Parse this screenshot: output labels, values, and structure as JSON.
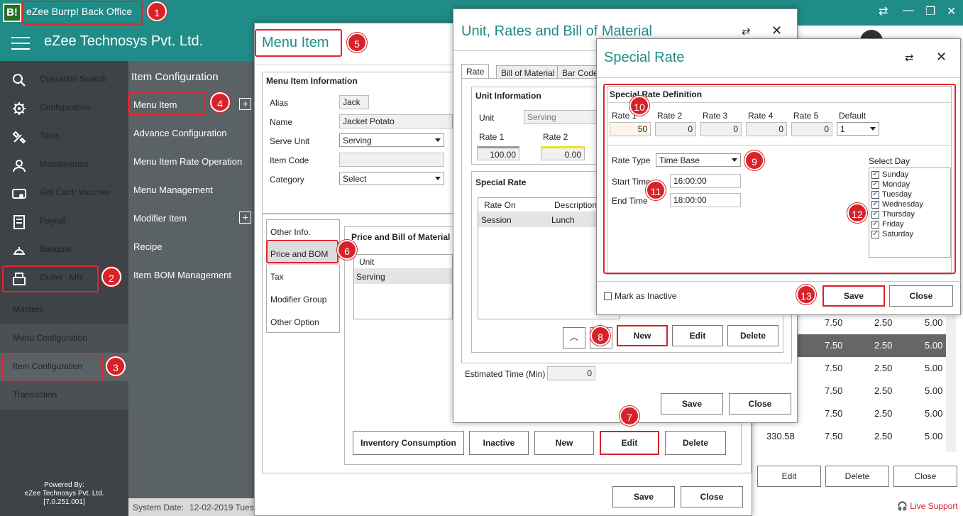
{
  "app": {
    "title": "eZee Burrp! Back Office",
    "logo_text": "B!",
    "company": "eZee Technosys Pvt. Ltd.",
    "brand_color": "#1f8c87"
  },
  "nav": {
    "items": [
      {
        "label": "Operation Search",
        "icon": "search-icon"
      },
      {
        "label": "Configuration",
        "icon": "gear-icon"
      },
      {
        "label": "Tools",
        "icon": "tools-icon"
      },
      {
        "label": "Maintenance",
        "icon": "worker-icon"
      },
      {
        "label": "Gift Card/ Voucher",
        "icon": "gift-card-icon"
      },
      {
        "label": "Payroll",
        "icon": "payroll-icon"
      },
      {
        "label": "Banquet",
        "icon": "banquet-icon"
      },
      {
        "label": "Outlet : MR",
        "icon": "register-icon"
      }
    ],
    "sections": [
      "Masters",
      "Menu Configuration",
      "Item Configuration",
      "Transaction"
    ],
    "powered_by": "Powered By:",
    "powered_company": "eZee Technosys Pvt. Ltd.",
    "version": "[7.0.251.001]"
  },
  "subnav": {
    "header": "Item Configuration",
    "items": [
      "Menu Item",
      "Advance Configuration",
      "Menu Item Rate Operation",
      "Menu Management",
      "Modifier Item",
      "Recipe",
      "Item BOM Management"
    ]
  },
  "status": {
    "system_date_label": "System Date:",
    "system_date": "12-02-2019 Tues"
  },
  "background_table": {
    "rows": [
      {
        "c1": "",
        "c2": "7.50",
        "c3": "2.50",
        "c4": "5.00"
      },
      {
        "c1": "",
        "c2": "7.50",
        "c3": "2.50",
        "c4": "5.00"
      },
      {
        "c1": "",
        "c2": "7.50",
        "c3": "2.50",
        "c4": "5.00"
      },
      {
        "c1": "",
        "c2": "7.50",
        "c3": "2.50",
        "c4": "5.00"
      },
      {
        "c1": "",
        "c2": "7.50",
        "c3": "2.50",
        "c4": "5.00"
      },
      {
        "c1": "330.58",
        "c2": "7.50",
        "c3": "2.50",
        "c4": "5.00"
      }
    ],
    "buttons": {
      "edit": "Edit",
      "delete": "Delete",
      "close": "Close"
    },
    "live_support": "Live Support"
  },
  "menu_item": {
    "title": "Menu Item",
    "info_header": "Menu Item Information",
    "alias_label": "Alias",
    "alias": "Jack",
    "name_label": "Name",
    "name": "Jacket Potato",
    "serve_unit_label": "Serve Unit",
    "serve_unit": "Serving",
    "item_code_label": "Item Code",
    "item_code": "",
    "category_label": "Category",
    "category": "Select",
    "side_tabs": [
      "Other Info.",
      "Price and BOM",
      "Tax",
      "Modifier Group",
      "Other Option"
    ],
    "price_header": "Price and Bill of Material",
    "unit_col": "Unit",
    "unit_row": "Serving",
    "buttons": {
      "inventory": "Inventory Consumption",
      "inactive": "Inactive",
      "new": "New",
      "edit": "Edit",
      "delete": "Delete",
      "save": "Save",
      "close": "Close"
    }
  },
  "unit_rates": {
    "title": "Unit, Rates and Bill of Material",
    "tabs": [
      "Rate",
      "Bill of Material",
      "Bar Code"
    ],
    "unit_info_header": "Unit Information",
    "unit_label": "Unit",
    "unit": "Serving",
    "rate1_label": "Rate 1",
    "rate1": "100.00",
    "rate2_label": "Rate 2",
    "rate2": "0.00",
    "special_rate_header": "Special Rate",
    "grid_cols": [
      "Rate On",
      "Description"
    ],
    "grid_row": [
      "Session",
      "Lunch"
    ],
    "buttons": {
      "new": "New",
      "edit": "Edit",
      "delete": "Delete",
      "save": "Save",
      "close": "Close"
    },
    "est_time_label": "Estimated Time (Min)",
    "est_time": "0"
  },
  "special_rate": {
    "title": "Special Rate",
    "definition_header": "Special Rate Definition",
    "rate_labels": [
      "Rate 1",
      "Rate 2",
      "Rate 3",
      "Rate 4",
      "Rate 5",
      "Default"
    ],
    "rate_values": [
      "50",
      "0",
      "0",
      "0",
      "0"
    ],
    "default_value": "1",
    "rate_type_label": "Rate Type",
    "rate_type": "Time Base",
    "start_time_label": "Start Time",
    "start_time": "16:00:00",
    "end_time_label": "End Time",
    "end_time": "18:00:00",
    "select_day_label": "Select Day",
    "days": [
      "Sunday",
      "Monday",
      "Tuesday",
      "Wednesday",
      "Thursday",
      "Friday",
      "Saturday"
    ],
    "mark_inactive": "Mark as Inactive",
    "save": "Save",
    "close": "Close"
  },
  "annotations": [
    "1",
    "2",
    "3",
    "4",
    "5",
    "6",
    "7",
    "8",
    "9",
    "10",
    "11",
    "12",
    "13"
  ]
}
